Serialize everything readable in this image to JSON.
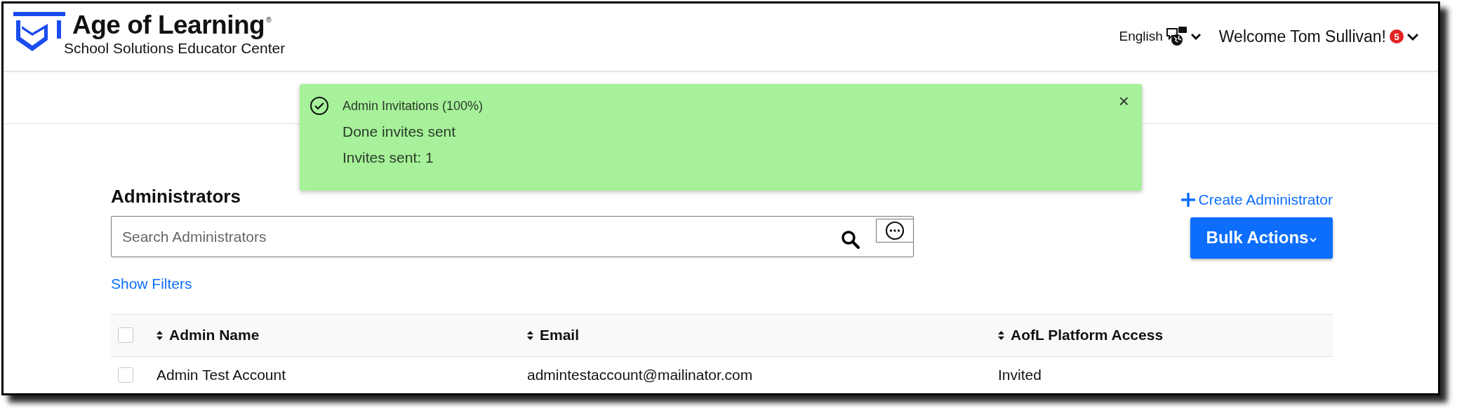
{
  "header": {
    "brand": "Age of Learning",
    "registered_mark": "®",
    "subtitle": "School Solutions Educator Center",
    "language": "English",
    "welcome": "Welcome Tom Sullivan!",
    "notification_count": "5"
  },
  "toast": {
    "title": "Admin Invitations (100%)",
    "lines": [
      "Done invites sent",
      "Invites sent: 1"
    ],
    "close": "×"
  },
  "section": {
    "title": "Administrators",
    "create_link": "Create Administrator",
    "bulk_button": "Bulk Actions",
    "search": {
      "placeholder": "Search Administrators"
    },
    "filters_link": "Show Filters"
  },
  "table": {
    "select_all": {
      "checked": false
    },
    "columns": [
      {
        "label": "Admin Name"
      },
      {
        "label": "Email"
      },
      {
        "label": "AofL Platform Access"
      }
    ],
    "rows": [
      {
        "checked": false,
        "cells": [
          "Admin Test Account",
          "admintestaccount@mailinator.com",
          "Invited"
        ]
      }
    ]
  }
}
